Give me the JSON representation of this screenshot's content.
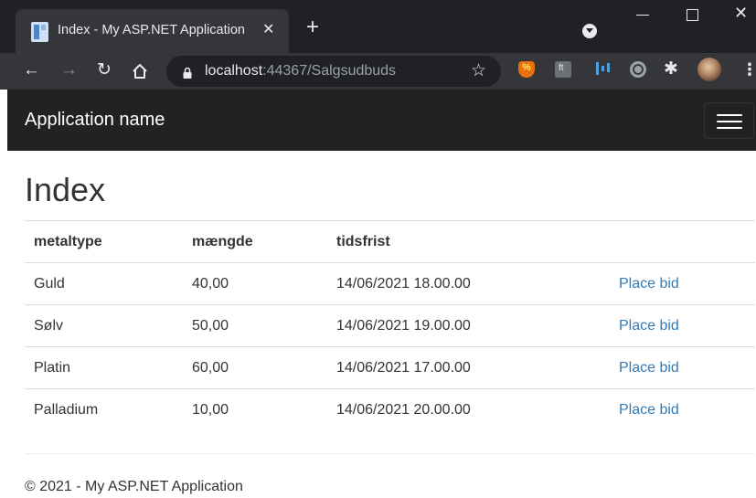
{
  "browser": {
    "tab_title": "Index - My ASP.NET Application",
    "tab_close": "✕",
    "new_tab": "+",
    "url_host": "localhost",
    "url_rest": ":44367/Salgsudbuds"
  },
  "icons": {
    "back": "arrow-left-icon",
    "forward": "arrow-right-icon",
    "reload": "reload-icon",
    "home": "home-icon",
    "lock": "lock-icon",
    "bookmark": "star-icon",
    "extensions": "puzzle-icon",
    "menu": "more-vertical-icon"
  },
  "navbar": {
    "brand": "Application name",
    "background": "#222222"
  },
  "main": {
    "title": "Index",
    "table": {
      "headers": [
        "metaltype",
        "mængde",
        "tidsfrist"
      ],
      "rows": [
        {
          "metaltype": "Guld",
          "maengde": "40,00",
          "tidsfrist": "14/06/2021 18.00.00",
          "action": "Place bid"
        },
        {
          "metaltype": "Sølv",
          "maengde": "50,00",
          "tidsfrist": "14/06/2021 19.00.00",
          "action": "Place bid"
        },
        {
          "metaltype": "Platin",
          "maengde": "60,00",
          "tidsfrist": "14/06/2021 17.00.00",
          "action": "Place bid"
        },
        {
          "metaltype": "Palladium",
          "maengde": "10,00",
          "tidsfrist": "14/06/2021 20.00.00",
          "action": "Place bid"
        }
      ]
    }
  },
  "footer": {
    "text": "© 2021 - My ASP.NET Application"
  },
  "colors": {
    "link": "#337ab7",
    "chrome_dark": "#202124",
    "chrome_toolbar": "#35363a"
  }
}
